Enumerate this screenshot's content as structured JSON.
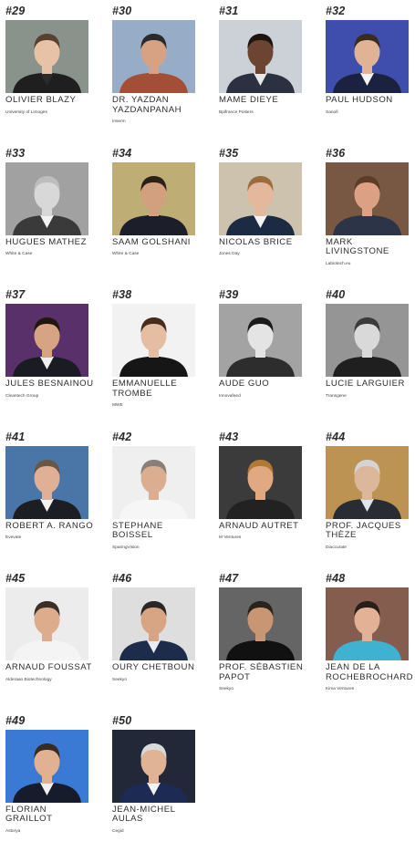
{
  "people": [
    {
      "rank": "#29",
      "name": "OLIVIER BLAZY",
      "org": "University of Limoges",
      "bg": "#7f8a83",
      "skin": "#e7c2a6",
      "hair": "#5a4030",
      "suit": "#1f1f1f",
      "shirt": "#2b2b2b"
    },
    {
      "rank": "#30",
      "name": "DR. YAZDAN YAZDANPANAH",
      "org": "Inserm",
      "bg": "#8fa5c2",
      "skin": "#d6a283",
      "hair": "#2a2a2a",
      "suit": "#a34f37",
      "shirt": "#a34f37"
    },
    {
      "rank": "#31",
      "name": "MAME DIEYE",
      "org": "Bpifrance Poitiers",
      "bg": "#c8cdd4",
      "skin": "#6b4532",
      "hair": "#1e1410",
      "suit": "#2b3140",
      "shirt": "#e8e8e8"
    },
    {
      "rank": "#32",
      "name": "PAUL HUDSON",
      "org": "Sanofi",
      "bg": "#2f3fa6",
      "skin": "#e1b396",
      "hair": "#3a2b20",
      "suit": "#1b2240",
      "shirt": "#f4f4f4"
    },
    {
      "rank": "#33",
      "name": "HUGUES MATHEZ",
      "org": "White & Case",
      "bg": "#9a9a9a",
      "skin": "#d8d8d8",
      "hair": "#bdbdbd",
      "suit": "#3a3a3a",
      "shirt": "#f2f2f2"
    },
    {
      "rank": "#34",
      "name": "SAAM GOLSHANI",
      "org": "White & Case",
      "bg": "#b9a86b",
      "skin": "#d2a07f",
      "hair": "#2b2118",
      "suit": "#1c1f2a",
      "shirt": "#1c1f2a"
    },
    {
      "rank": "#35",
      "name": "NICOLAS BRICE",
      "org": "Jones Day",
      "bg": "#c9bda8",
      "skin": "#e3b89d",
      "hair": "#9c6d3c",
      "suit": "#1d2a44",
      "shirt": "#f4f4f4"
    },
    {
      "rank": "#36",
      "name": "MARK LIVINGSTONE",
      "org": "Labiotech.eu",
      "bg": "#6d4a34",
      "skin": "#dca184",
      "hair": "#5b3d28",
      "suit": "#2c3448",
      "shirt": "#2c3448"
    },
    {
      "rank": "#37",
      "name": "JULES BESNAINOU",
      "org": "Cleantech Group",
      "bg": "#4b1f5e",
      "skin": "#d6a383",
      "hair": "#22170f",
      "suit": "#1b1b24",
      "shirt": "#f0f0f0"
    },
    {
      "rank": "#38",
      "name": "EMMANUELLE TROMBE",
      "org": "MWE",
      "bg": "#f1f1f1",
      "skin": "#e5bda2",
      "hair": "#4a2c1c",
      "suit": "#161616",
      "shirt": "#161616"
    },
    {
      "rank": "#39",
      "name": "AUDE GUO",
      "org": "Innovafeed",
      "bg": "#9c9c9c",
      "skin": "#e4e4e4",
      "hair": "#1b1b1b",
      "suit": "#2d2d2d",
      "shirt": "#2d2d2d"
    },
    {
      "rank": "#40",
      "name": "LUCIE LARGUIER",
      "org": "Transgene",
      "bg": "#8c8c8c",
      "skin": "#d9d9d9",
      "hair": "#3b3b3b",
      "suit": "#1f1f1f",
      "shirt": "#1f1f1f"
    },
    {
      "rank": "#41",
      "name": "ROBERT A. RANGO",
      "org": "Evevate",
      "bg": "#3b6aa0",
      "skin": "#dfb095",
      "hair": "#6a5646",
      "suit": "#1d1d24",
      "shirt": "#f2f2f2"
    },
    {
      "rank": "#42",
      "name": "STEPHANE BOISSEL",
      "org": "SparingVision",
      "bg": "#eeeeee",
      "skin": "#dcae91",
      "hair": "#8a7f78",
      "suit": "#f6f6f6",
      "shirt": "#f6f6f6"
    },
    {
      "rank": "#43",
      "name": "ARNAUD AUTRET",
      "org": "M Ventures",
      "bg": "#2b2b2b",
      "skin": "#e0a982",
      "hair": "#b07a35",
      "suit": "#222222",
      "shirt": "#222222"
    },
    {
      "rank": "#44",
      "name": "PROF. JACQUES THÈZE",
      "org": "Diaccurate",
      "bg": "#b78a45",
      "skin": "#dcb79c",
      "hair": "#d4d4d4",
      "suit": "#2a2c33",
      "shirt": "#dfe6ee"
    },
    {
      "rank": "#45",
      "name": "ARNAUD FOUSSAT",
      "org": "Alderaan Biotechnology",
      "bg": "#ebebeb",
      "skin": "#ddac8d",
      "hair": "#3d2f26",
      "suit": "#f4f4f4",
      "shirt": "#f4f4f4"
    },
    {
      "rank": "#46",
      "name": "OURY CHETBOUN",
      "org": "Seekyo",
      "bg": "#dcdcdc",
      "skin": "#d7a484",
      "hair": "#2c2624",
      "suit": "#1d2c4a",
      "shirt": "#e9eef6"
    },
    {
      "rank": "#47",
      "name": "PROF. SÉBASTIEN PAPOT",
      "org": "Seekyo",
      "bg": "#585858",
      "skin": "#c99673",
      "hair": "#2a221c",
      "suit": "#111111",
      "shirt": "#111111"
    },
    {
      "rank": "#48",
      "name": "JEAN DE LA ROCHEBROCHARD",
      "org": "Kima Ventures",
      "bg": "#7a5040",
      "skin": "#e3b196",
      "hair": "#2a1e18",
      "suit": "#3fb2d1",
      "shirt": "#3fb2d1"
    },
    {
      "rank": "#49",
      "name": "FLORIAN GRAILLOT",
      "org": "Astorya",
      "bg": "#2b6fd1",
      "skin": "#e2b093",
      "hair": "#3a2a20",
      "suit": "#171c2c",
      "shirt": "#f1f1f1"
    },
    {
      "rank": "#50",
      "name": "JEAN-MICHEL AULAS",
      "org": "Cegid",
      "bg": "#101626",
      "skin": "#e0b296",
      "hair": "#d9d9d9",
      "suit": "#1d2a54",
      "shirt": "#f2f2f2"
    }
  ]
}
